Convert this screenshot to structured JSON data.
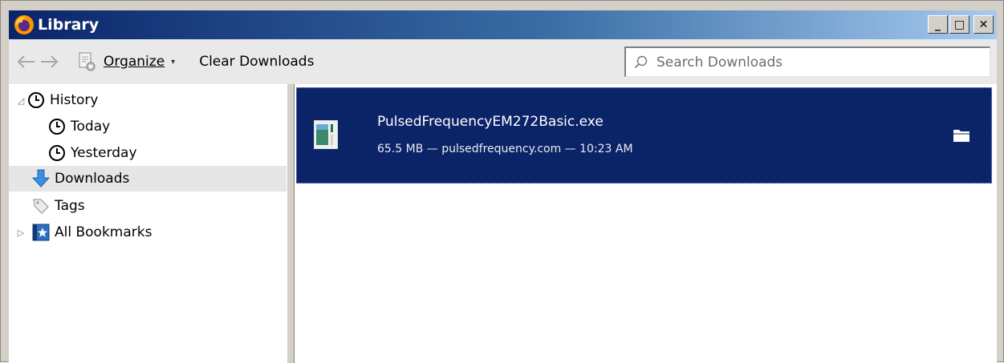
{
  "window": {
    "title": "Library",
    "controls": {
      "minimize": "_",
      "maximize": "□",
      "close": "✕"
    }
  },
  "toolbar": {
    "back_icon": "back-arrow-icon",
    "forward_icon": "forward-arrow-icon",
    "organize_label": "Organize",
    "organize_caret": "▾",
    "clear_label": "Clear Downloads",
    "search_placeholder": "Search Downloads",
    "search_value": ""
  },
  "sidebar": {
    "items": [
      {
        "label": "History",
        "icon": "clock-icon",
        "twisty": "◿"
      },
      {
        "label": "Today",
        "icon": "clock-icon"
      },
      {
        "label": "Yesterday",
        "icon": "clock-icon"
      },
      {
        "label": "Downloads",
        "icon": "download-arrow-icon"
      },
      {
        "label": "Tags",
        "icon": "tag-icon"
      },
      {
        "label": "All Bookmarks",
        "icon": "bookmarks-star-icon",
        "twisty": "▷"
      }
    ]
  },
  "downloads": [
    {
      "file_name": "PulsedFrequencyEM272Basic.exe",
      "meta": "65.5 MB — pulsedfrequency.com — 10:23 AM"
    }
  ],
  "colors": {
    "selection_bg": "#0b2467",
    "titlebar_start": "#0a246a",
    "titlebar_end": "#a6caf0"
  }
}
